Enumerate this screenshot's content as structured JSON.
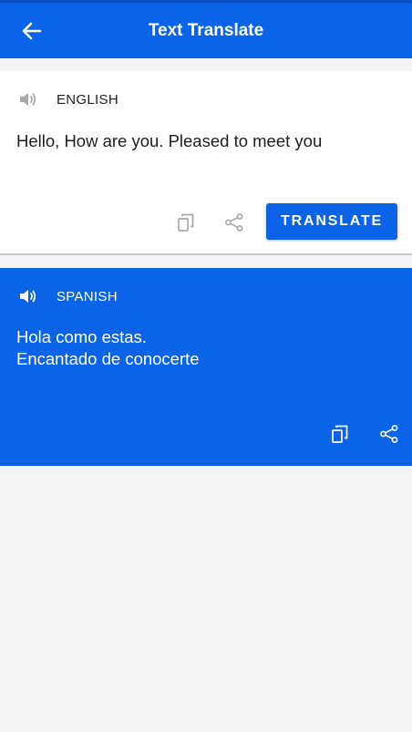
{
  "header": {
    "title": "Text Translate",
    "back_icon": "arrow-left-icon"
  },
  "source": {
    "language": "ENGLISH",
    "text": "Hello, How are you. Pleased to meet you",
    "speaker_icon": "speaker-icon",
    "copy_icon": "copy-icon",
    "share_icon": "share-icon",
    "translate_label": "TRANSLATE"
  },
  "target": {
    "language": "SPANISH",
    "lines": [
      "Hola como estas.",
      "Encantado de conocerte"
    ],
    "speaker_icon": "speaker-icon",
    "copy_icon": "copy-icon",
    "share_icon": "share-icon"
  },
  "colors": {
    "accent": "#0b63e8",
    "background": "#f4f4f6",
    "muted_icon": "#a7a7aa"
  }
}
